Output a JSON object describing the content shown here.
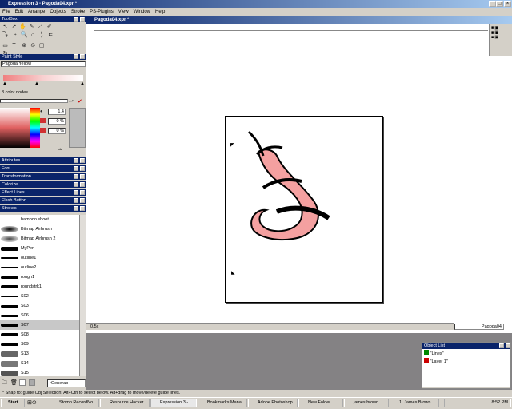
{
  "app": {
    "title": "Expression 3 - Pagoda04.xpr *"
  },
  "menu": [
    "File",
    "Edit",
    "Arrange",
    "Objects",
    "Stroke",
    "PS-Plugins",
    "View",
    "Window",
    "Help"
  ],
  "toolbox": {
    "title": "ToolBox"
  },
  "paint_style": {
    "title": "Paint Style",
    "name": "Pagoda Yellow",
    "nodes": "3 color nodes",
    "field1": "1.4",
    "field2": "0 %",
    "field3": "0 %"
  },
  "panels": {
    "attributes": "Attributes",
    "font": "Font",
    "transformation": "Transformation",
    "colorize": "Colorize",
    "effect_lines": "Effect Lines",
    "flash_button": "Flash Button",
    "strokes": "Strokes"
  },
  "strokes": [
    "bamboo shoot",
    "Bitmap Airbrush",
    "Bitmap Airbrush 2",
    "MyPen",
    "outline1",
    "outline2",
    "rough1",
    "roundstrk1",
    "S02",
    "S03",
    "S06",
    "S07",
    "S08",
    "S09",
    "S13",
    "S14",
    "S15"
  ],
  "strokes_footer": {
    "dropdown": "rGenerab"
  },
  "document": {
    "title": "Pagoda04.xpr *",
    "zoom": "0.5x",
    "page_name": "Pagoda04"
  },
  "object_list": {
    "title": "Object List",
    "items": [
      "\"Lines\"",
      "\"Layer 1\""
    ]
  },
  "status": {
    "text": "* Snap to: guide   Obj Selection: Alt+Ctrl to select below. Alt+drag to move/delete guide lines."
  },
  "taskbar": {
    "start": "Start",
    "tasks": [
      "Stomp RecordNo...",
      "Resource Hacker...",
      "Expression 3 - ...",
      "Bookmarks Mana...",
      "Adobe Photoshop",
      "New Folder",
      "james brown",
      "1. James Brown ..."
    ],
    "clock": "8:52 PM"
  },
  "colors": {
    "titlebar": "#0a246a",
    "shape_fill": "#f4a0a0",
    "stroke": "#000000"
  }
}
